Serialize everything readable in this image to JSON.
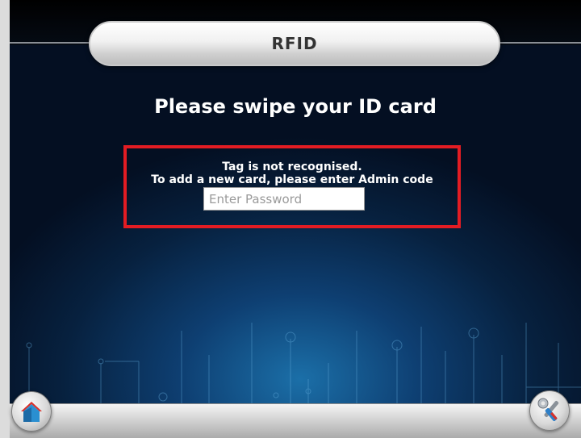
{
  "header": {
    "title": "RFID"
  },
  "main": {
    "heading": "Please swipe your ID card",
    "alert": {
      "line1": "Tag is not recognised.",
      "line2": "To add a new card, please enter Admin code",
      "password_placeholder": "Enter Password",
      "password_value": ""
    }
  },
  "footer": {
    "home_icon": "home-icon",
    "settings_icon": "tools-icon"
  },
  "colors": {
    "alert_border": "#e31c23",
    "background_dark": "#040f22",
    "background_glow": "#1b6fa8"
  }
}
